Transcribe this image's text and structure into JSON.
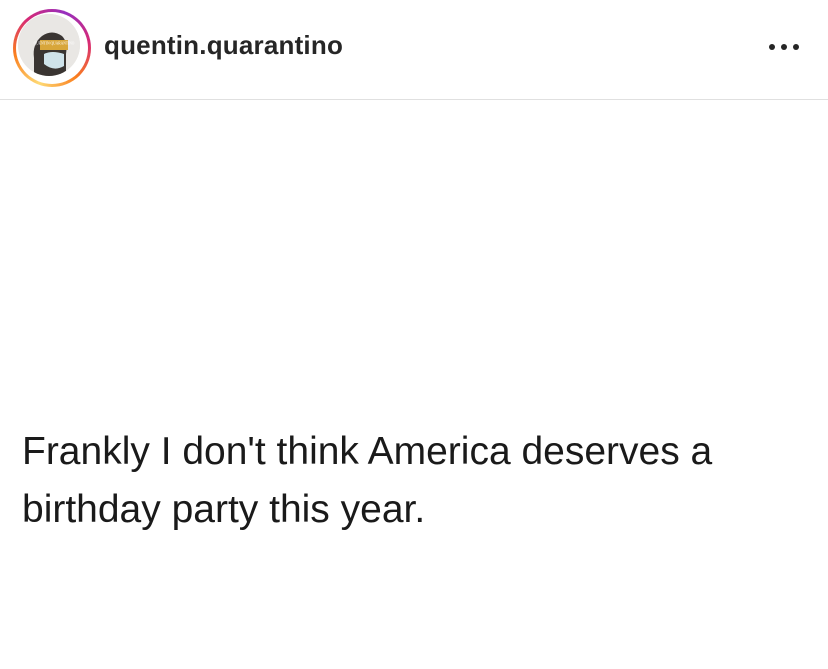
{
  "post": {
    "username": "quentin.quarantino",
    "avatar_label": "QUENTIN QUARANTINO",
    "more_icon": "more-horizontal-icon",
    "text": "Frankly I don't think America deserves a birthday party this year."
  },
  "colors": {
    "username": "#262626",
    "text": "#1a1a1a",
    "divider": "#e0e0e0",
    "story_ring": [
      "#feda75",
      "#fa7e1e",
      "#d62976",
      "#962fbf"
    ]
  }
}
